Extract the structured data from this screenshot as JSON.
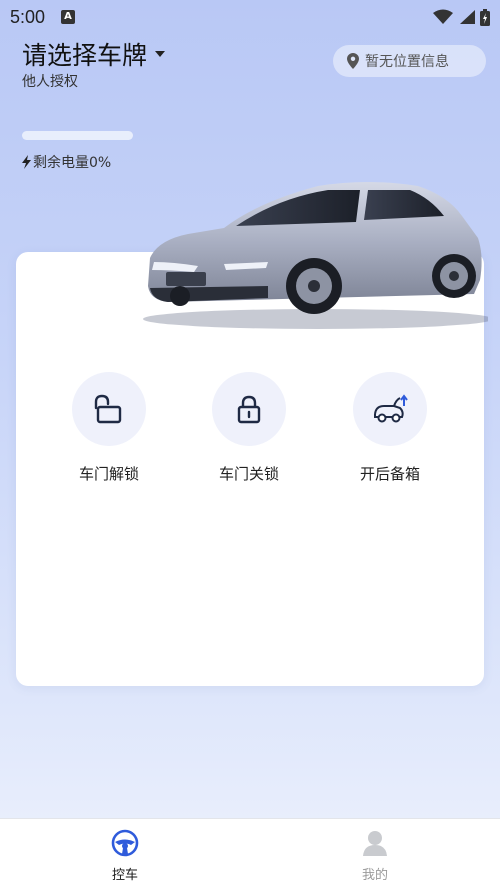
{
  "status_bar": {
    "time": "5:00",
    "notification_icon": "A"
  },
  "header": {
    "plate_title": "请选择车牌",
    "auth_label": "他人授权",
    "location_text": "暂无位置信息"
  },
  "battery": {
    "level_percent": 0,
    "text": "剩余电量0%"
  },
  "actions": [
    {
      "label": "车门解锁",
      "icon": "unlock-icon"
    },
    {
      "label": "车门关锁",
      "icon": "lock-icon"
    },
    {
      "label": "开后备箱",
      "icon": "trunk-open-icon"
    }
  ],
  "bottom_nav": [
    {
      "label": "控车",
      "icon": "steering-wheel-icon",
      "active": true
    },
    {
      "label": "我的",
      "icon": "profile-icon",
      "active": false
    }
  ],
  "colors": {
    "accent": "#2f5bdb",
    "icon_dark": "#1f2a44",
    "nav_inactive": "#9a9a9a"
  }
}
